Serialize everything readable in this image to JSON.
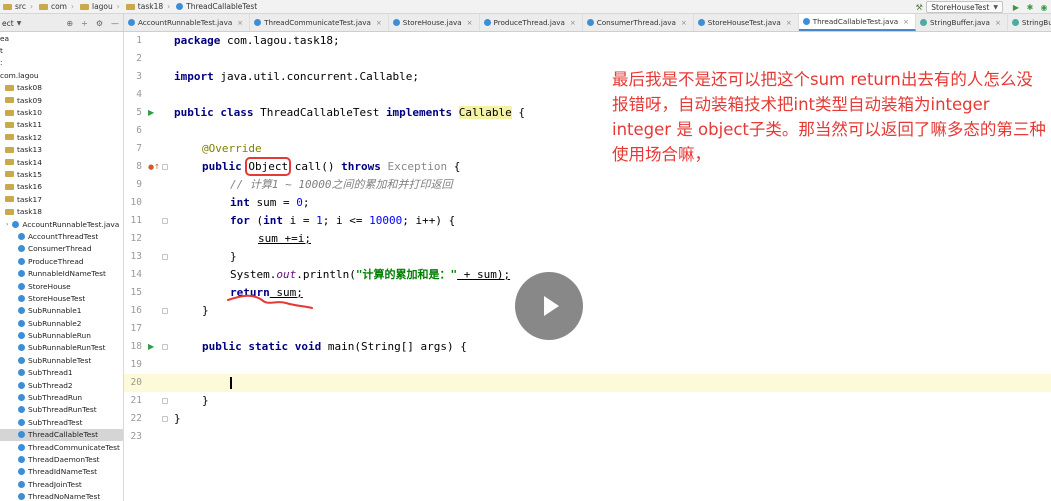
{
  "breadcrumbs": [
    "src",
    "com",
    "lagou",
    "task18",
    "ThreadCallableTest"
  ],
  "run_config": {
    "label": "StoreHouseTest"
  },
  "project_panel": {
    "label": "ect"
  },
  "tabs": [
    {
      "label": "AccountRunnableTest.java",
      "active": false
    },
    {
      "label": "ThreadCommunicateTest.java",
      "active": false
    },
    {
      "label": "StoreHouse.java",
      "active": false
    },
    {
      "label": "ProduceThread.java",
      "active": false
    },
    {
      "label": "ConsumerThread.java",
      "active": false
    },
    {
      "label": "StoreHouseTest.java",
      "active": false
    },
    {
      "label": "ThreadCallableTest.java",
      "active": true
    },
    {
      "label": "StringBuffer.java",
      "active": false
    },
    {
      "label": "StringBuilder",
      "active": false
    }
  ],
  "tree": {
    "top": [
      "ea",
      "t",
      ":"
    ],
    "package": "com.lagou",
    "folders": [
      "task08",
      "task09",
      "task10",
      "task11",
      "task12",
      "task13",
      "task14",
      "task15",
      "task16",
      "task17",
      "task18"
    ],
    "classes": [
      "AccountRunnableTest.java",
      "AccountThreadTest",
      "ConsumerThread",
      "ProduceThread",
      "RunnableIdNameTest",
      "StoreHouse",
      "StoreHouseTest",
      "SubRunnable1",
      "SubRunnable2",
      "SubRunnableRun",
      "SubRunnableRunTest",
      "SubRunnableTest",
      "SubThread1",
      "SubThread2",
      "SubThreadRun",
      "SubThreadRunTest",
      "SubThreadTest",
      "ThreadCallableTest",
      "ThreadCommunicateTest",
      "ThreadDaemonTest",
      "ThreadIdNameTest",
      "ThreadJoinTest",
      "ThreadNoNameTest"
    ],
    "selected": "ThreadCallableTest"
  },
  "code": {
    "l1_pkg": "package",
    "l1_name": " com.lagou.task18;",
    "l3_imp": "import",
    "l3_name": " java.util.concurrent.Callable;",
    "l5_mods": "public class",
    "l5_cls": " ThreadCallableTest ",
    "l5_impl": "implements",
    "l5_sp": " ",
    "l5_iface": "Callable",
    "l5_brace": " {",
    "l7_ann": "@Override",
    "l8_pub": "public",
    "l8_type": "Object",
    "l8_sig": " call() ",
    "l8_throws": "throws",
    "l8_exc": " Exception",
    "l8_brace": " {",
    "l9_cm": "// 计算1 ~ 10000之间的累加和并打印返回",
    "l10_int": "int",
    "l10_rest1": " sum = ",
    "l10_num": "0",
    "l10_rest2": ";",
    "l11_for": "for",
    "l11_a": " (",
    "l11_int": "int",
    "l11_b": " i = ",
    "l11_n1": "1",
    "l11_c": "; i <= ",
    "l11_n2": "10000",
    "l11_d": "; i++) {",
    "l12": "sum +=i;",
    "l13": "}",
    "l14_sys": "System.",
    "l14_out": "out",
    "l14_pr": ".println(",
    "l14_str": "\"计算的累加和是：\"",
    "l14_end": " + sum);",
    "l15_ret": "return",
    "l15_sum": " sum;",
    "l16": "}",
    "l18_mods": "public static void",
    "l18_rest": " main(String[] args) {",
    "l21": "}",
    "l22": "}",
    "line_numbers": [
      "1",
      "2",
      "3",
      "4",
      "5",
      "6",
      "7",
      "8",
      "9",
      "10",
      "11",
      "12",
      "13",
      "14",
      "15",
      "16",
      "17",
      "18",
      "19",
      "20",
      "21",
      "22",
      "23"
    ]
  },
  "note": "最后我是不是还可以把这个sum return出去有的人怎么没报错呀，自动装箱技术把int类型自动装箱为integer integer 是 object子类。那当然可以返回了嘛多态的第三种使用场合嘛，",
  "colors": {
    "annotation_red": "#e53935",
    "current_line": "#fcfad8",
    "keyword": "#000080"
  }
}
